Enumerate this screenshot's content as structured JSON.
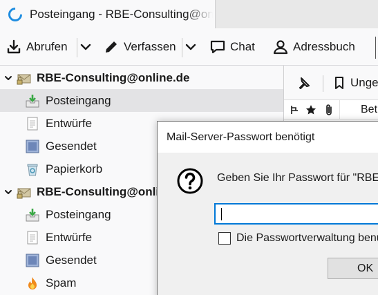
{
  "window": {
    "tab_title": "Posteingang - RBE-Consulting@online.de"
  },
  "toolbar": {
    "get_messages": "Abrufen",
    "write": "Verfassen",
    "chat": "Chat",
    "address_book": "Adressbuch"
  },
  "folders": {
    "account1": {
      "name": "RBE-Consulting@online.de",
      "items": [
        {
          "label": "Posteingang",
          "icon": "inbox-icon"
        },
        {
          "label": "Entwürfe",
          "icon": "drafts-icon"
        },
        {
          "label": "Gesendet",
          "icon": "sent-icon"
        },
        {
          "label": "Papierkorb",
          "icon": "trash-icon"
        }
      ]
    },
    "account2": {
      "name": "RBE-Consulting@online.de",
      "items": [
        {
          "label": "Posteingang",
          "icon": "inbox-icon"
        },
        {
          "label": "Entwürfe",
          "icon": "drafts-icon"
        },
        {
          "label": "Gesendet",
          "icon": "sent-icon"
        },
        {
          "label": "Spam",
          "icon": "spam-icon"
        }
      ]
    }
  },
  "thread": {
    "quickfilter_unread": "Ungelesen",
    "column_subject": "Betreff"
  },
  "dialog": {
    "title": "Mail-Server-Passwort benötigt",
    "message": "Geben Sie Ihr Passwort für \"RBE-Consulting@online.de\" ein:",
    "password_value": "",
    "checkbox_label": "Die Passwortverwaltung benutzen, um dieses Passwort zu speichern.",
    "checkbox_checked": false,
    "ok_label": "OK"
  },
  "colors": {
    "accent": "#0078d7",
    "tab_icon": "#1f8de0",
    "selected_row": "#e3e3e5",
    "inbox_arrow": "#3aa845"
  }
}
